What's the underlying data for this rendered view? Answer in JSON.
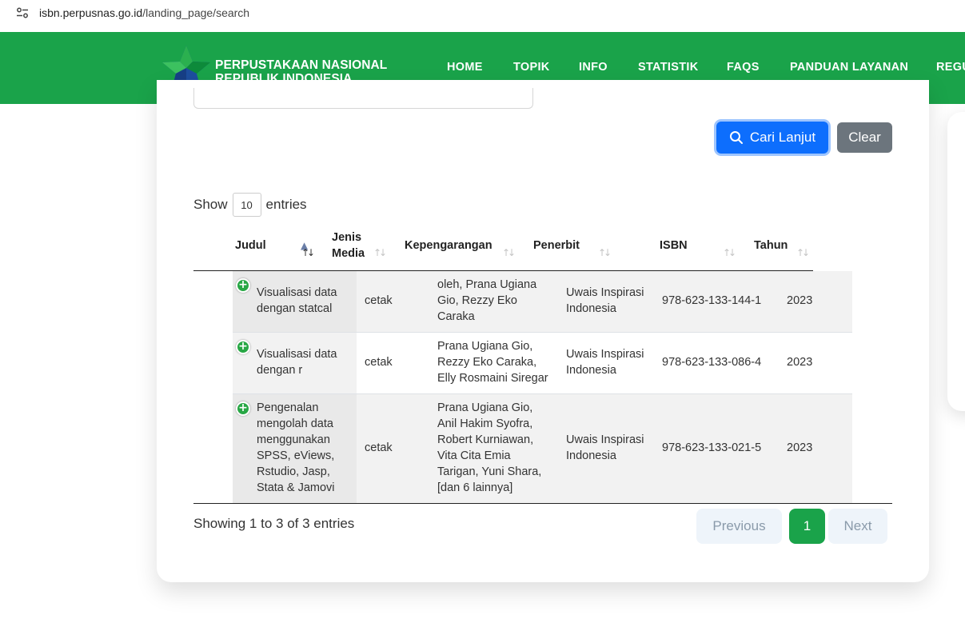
{
  "browser": {
    "url_host": "isbn.perpusnas.go.id",
    "url_path": "/landing_page/search"
  },
  "navbar": {
    "brand_line1": "PERPUSTAKAAN NASIONAL",
    "brand_line2": "REPUBLIK INDONESIA",
    "items": [
      "HOME",
      "TOPIK",
      "INFO",
      "STATISTIK",
      "FAQS",
      "PANDUAN LAYANAN",
      "REGU"
    ],
    "accent_color": "#1aa34a"
  },
  "search": {
    "cari_label": "Cari Lanjut",
    "clear_label": "Clear"
  },
  "table_controls": {
    "show_label": "Show",
    "entries_value": "10",
    "entries_label": "entries"
  },
  "table": {
    "headers": [
      "Judul",
      "Jenis Media",
      "Kepengarangan",
      "Penerbit",
      "ISBN",
      "Tahun"
    ],
    "header_jenis_line1": "Jenis",
    "header_jenis_line2": "Media",
    "rows": [
      {
        "judul": [
          "Visualisasi data",
          "dengan statcal"
        ],
        "jenis": "cetak",
        "kepengarangan": [
          "oleh, Prana Ugiana",
          "Gio, Rezzy Eko",
          "Caraka"
        ],
        "penerbit": [
          "Uwais Inspirasi",
          "Indonesia"
        ],
        "isbn": "978-623-133-144-1",
        "tahun": "2023"
      },
      {
        "judul": [
          "Visualisasi data",
          "dengan r"
        ],
        "jenis": "cetak",
        "kepengarangan": [
          "Prana Ugiana Gio,",
          "Rezzy Eko Caraka,",
          "Elly Rosmaini Siregar"
        ],
        "penerbit": [
          "Uwais Inspirasi",
          "Indonesia"
        ],
        "isbn": "978-623-133-086-4",
        "tahun": "2023"
      },
      {
        "judul": [
          "Pengenalan",
          "mengolah data",
          "menggunakan",
          "SPSS, eViews,",
          "Rstudio, Jasp,",
          "Stata & Jamovi"
        ],
        "jenis": "cetak",
        "kepengarangan": [
          "Prana Ugiana Gio,",
          "Anil Hakim Syofra,",
          "Robert Kurniawan,",
          "Vita Cita Emia",
          "Tarigan, Yuni Shara,",
          "[dan 6 lainnya]"
        ],
        "penerbit": [
          "Uwais Inspirasi",
          "Indonesia"
        ],
        "isbn": "978-623-133-021-5",
        "tahun": "2023"
      }
    ]
  },
  "footer": {
    "showing_text": "Showing 1 to 3 of 3 entries",
    "prev_label": "Previous",
    "page_1": "1",
    "next_label": "Next"
  }
}
